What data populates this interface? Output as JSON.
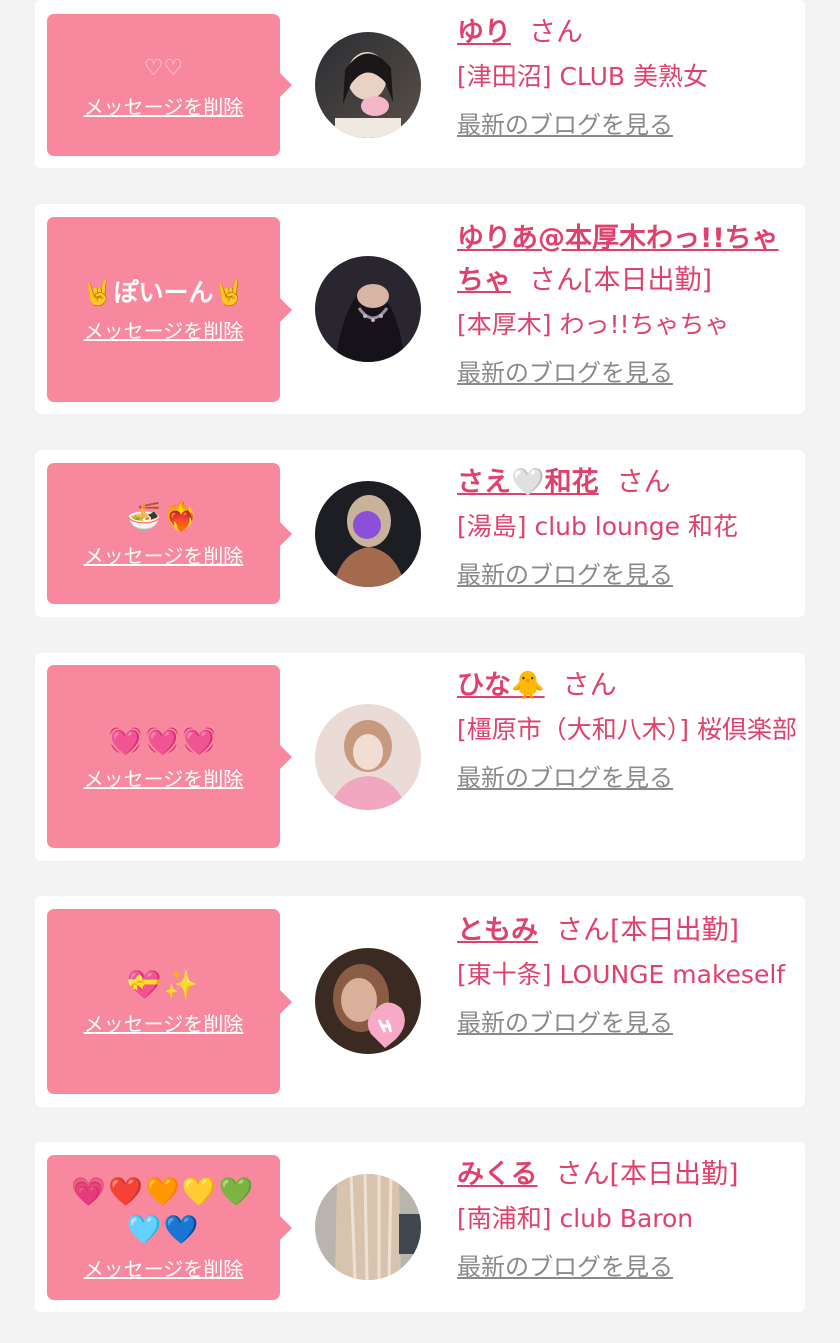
{
  "delete_label": "メッセージを削除",
  "blog_label": "最新のブログを見る",
  "san_label": "さん",
  "cards": [
    {
      "message": "♡♡",
      "name": "ゆり",
      "suffix": "",
      "shop": "[津田沼] CLUB 美熟女"
    },
    {
      "message": "🤘ぽいーん🤘",
      "name": "ゆりあ@本厚木わっ!!ちゃちゃ",
      "suffix": "[本日出勤]",
      "shop": "[本厚木] わっ!!ちゃちゃ"
    },
    {
      "message": "🍜❤️‍🔥",
      "name": "さえ🤍和花",
      "suffix": "",
      "shop": "[湯島] club lounge 和花"
    },
    {
      "message": "💓💓💓",
      "name": "ひな🐥",
      "suffix": "",
      "shop": "[橿原市（大和八木）] 桜倶楽部"
    },
    {
      "message": "💝✨",
      "name": "ともみ",
      "suffix": "[本日出勤]",
      "shop": "[東十条] LOUNGE makeself"
    },
    {
      "message": "💗❤️🧡💛💚🩵💙",
      "name": "みくる",
      "suffix": "[本日出勤]",
      "shop": "[南浦和] club Baron"
    }
  ],
  "colors": {
    "bubble": "#f7889d",
    "accent": "#e0406c",
    "link_gray": "#8a8a8a",
    "background": "#f3f3f3"
  }
}
